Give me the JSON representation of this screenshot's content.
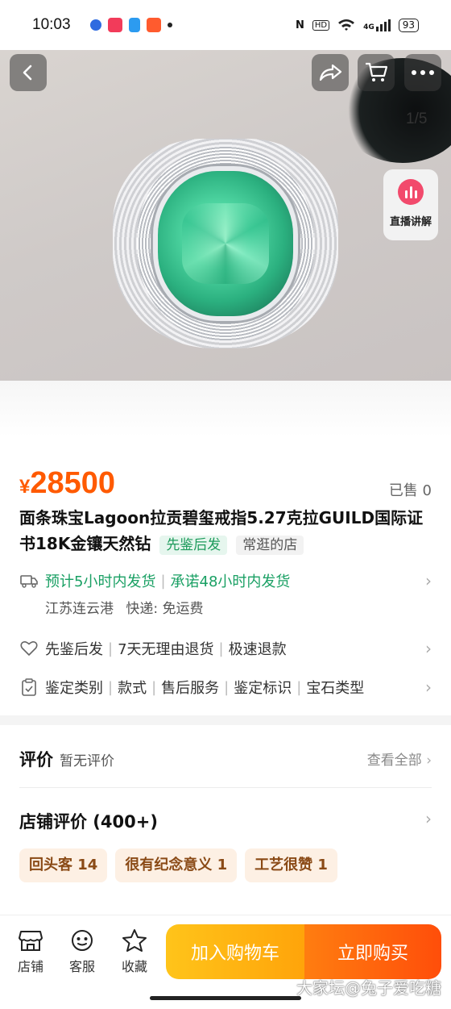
{
  "status_bar": {
    "time": "10:03",
    "signal_text": "4G",
    "battery": "93"
  },
  "hero": {
    "page_indicator": "1/5",
    "live_label": "直播讲解"
  },
  "product": {
    "currency": "¥",
    "price": "28500",
    "sold": "已售 0",
    "title": "面条珠宝Lagoon拉贡碧玺戒指5.27克拉GUILD国际证书18K金镶天然钻",
    "tag_primary": "先鉴后发",
    "tag_secondary": "常逛的店"
  },
  "shipping": {
    "ship_time": "预计5小时内发货",
    "promise": "承诺48小时内发货",
    "origin": "江苏连云港",
    "delivery": "快递: 免运费"
  },
  "guarantee": {
    "items": [
      "先鉴后发",
      "7天无理由退货",
      "极速退款"
    ]
  },
  "params": {
    "items": [
      "鉴定类别",
      "款式",
      "售后服务",
      "鉴定标识",
      "宝石类型"
    ]
  },
  "reviews": {
    "title": "评价",
    "subtitle": "暂无评价",
    "see_all": "查看全部"
  },
  "shop_reviews": {
    "title": "店铺评价 (400+)",
    "chips": [
      "回头客 14",
      "很有纪念意义 1",
      "工艺很赞 1"
    ]
  },
  "bottom_bar": {
    "nav": [
      {
        "label": "店铺",
        "icon": "shop-icon"
      },
      {
        "label": "客服",
        "icon": "customer-service-icon"
      },
      {
        "label": "收藏",
        "icon": "star-icon"
      }
    ],
    "add_to_cart": "加入购物车",
    "buy_now": "立即购买"
  },
  "watermark": "大家坛@兔子爱吃糖",
  "colors": {
    "price": "#ff5a00",
    "accent_green": "#1aa064",
    "cart_button": "#ffb20f",
    "buy_button": "#ff5a0a"
  }
}
